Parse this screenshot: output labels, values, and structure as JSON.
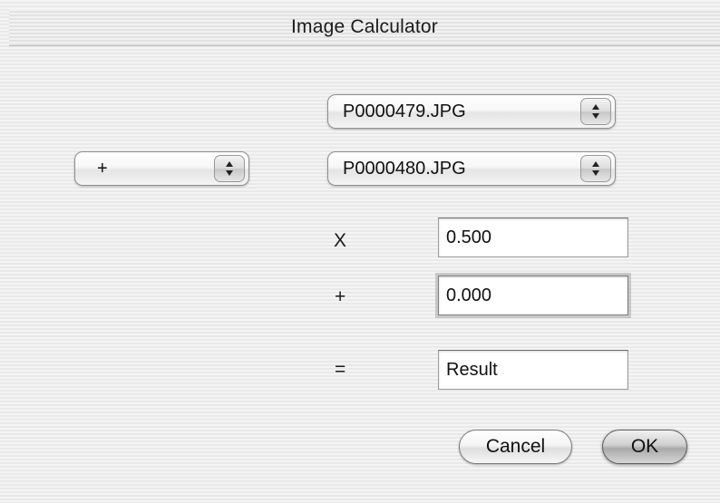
{
  "window": {
    "title": "Image Calculator"
  },
  "operation_popup": {
    "selected": "+"
  },
  "image1_popup": {
    "selected": "P0000479.JPG"
  },
  "image2_popup": {
    "selected": "P0000480.JPG"
  },
  "multiply": {
    "label": "X",
    "value": "0.500"
  },
  "add": {
    "label": "+",
    "value": "0.000"
  },
  "result": {
    "label": "=",
    "value": "Result"
  },
  "buttons": {
    "cancel": "Cancel",
    "ok": "OK"
  },
  "icons": {
    "popup_arrows": "up-down-arrows-icon"
  }
}
